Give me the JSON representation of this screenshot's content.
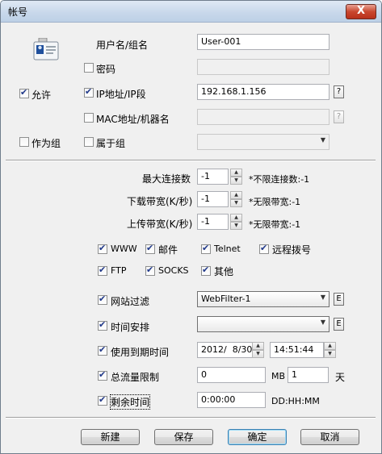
{
  "window": {
    "title": "帐号",
    "close_glyph": "X"
  },
  "icons": {
    "user_card": "id-card-icon"
  },
  "account": {
    "username_label": "用户名/组名",
    "username_value": "User-001",
    "password_label": "密码",
    "password_value": "",
    "allow_label": "允许",
    "ip_label": "IP地址/IP段",
    "ip_value": "192.168.1.156",
    "ip_help": "?",
    "mac_label": "MAC地址/机器名",
    "mac_value": "",
    "mac_help": "?",
    "as_group_label": "作为组",
    "belongs_group_label": "属于组",
    "group_value": ""
  },
  "limits": {
    "max_conn_label": "最大连接数",
    "max_conn_value": "-1",
    "max_conn_hint": "*不限连接数:-1",
    "down_label": "下载带宽(K/秒)",
    "down_value": "-1",
    "down_hint": "*无限带宽:-1",
    "up_label": "上传带宽(K/秒)",
    "up_value": "-1",
    "up_hint": "*无限带宽:-1"
  },
  "protocols": [
    {
      "label": "WWW",
      "checked": true
    },
    {
      "label": "邮件",
      "checked": true
    },
    {
      "label": "Telnet",
      "checked": true
    },
    {
      "label": "远程拨号",
      "checked": true
    },
    {
      "label": "FTP",
      "checked": true
    },
    {
      "label": "SOCKS",
      "checked": true
    },
    {
      "label": "其他",
      "checked": true
    }
  ],
  "filters": {
    "web_filter_label": "网站过滤",
    "web_filter_value": "WebFilter-1",
    "web_filter_edit": "E",
    "schedule_label": "时间安排",
    "schedule_value": "",
    "schedule_edit": "E",
    "expiry_label": "使用到期时间",
    "expiry_date": "2012/  8/30",
    "expiry_time": "14:51:44",
    "traffic_label": "总流量限制",
    "traffic_value": "0",
    "traffic_unit": "MB",
    "traffic_days": "1",
    "traffic_days_unit": "天",
    "remaining_label": "剩余时间",
    "remaining_value": "0:00:00",
    "remaining_format": "DD:HH:MM"
  },
  "buttons": {
    "new": "新建",
    "save": "保存",
    "ok": "确定",
    "cancel": "取消"
  }
}
